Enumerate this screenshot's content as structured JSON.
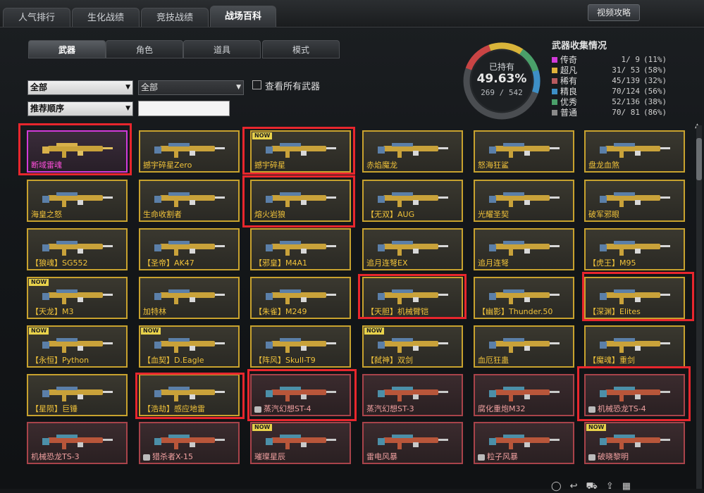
{
  "top_tabs": [
    "人气排行",
    "生化战绩",
    "竞技战绩",
    "战场百科"
  ],
  "video_button": "视频攻略",
  "sub_tabs": [
    "武器",
    "角色",
    "道具",
    "模式"
  ],
  "filters": {
    "category": "全部",
    "subcategory": "全部",
    "sort": "推荐顺序",
    "search_value": "",
    "view_all_label": "查看所有武器"
  },
  "owned": {
    "label": "已持有",
    "percent": "49.63%",
    "count": "269 / 542",
    "fraction": 0.4963
  },
  "collection": {
    "title": "武器收集情况",
    "rows": [
      {
        "tier": "传奇",
        "count": "1/  9",
        "pct": "(11%)",
        "color": "#d23ad9"
      },
      {
        "tier": "超凡",
        "count": "31/ 53",
        "pct": "(58%)",
        "color": "#e0b23a"
      },
      {
        "tier": "稀有",
        "count": "45/139",
        "pct": "(32%)",
        "color": "#b85a5f"
      },
      {
        "tier": "精良",
        "count": "70/124",
        "pct": "(56%)",
        "color": "#3d8fc6"
      },
      {
        "tier": "优秀",
        "count": "52/136",
        "pct": "(38%)",
        "color": "#4aa06a"
      },
      {
        "tier": "普通",
        "count": "70/ 81",
        "pct": "(86%)",
        "color": "#8a8a8a"
      }
    ]
  },
  "ring_colors": {
    "segment_a": "#c94444",
    "segment_b": "#d9b43a",
    "segment_c": "#4aa06a",
    "segment_d": "#3d8fc6",
    "track": "#4a4d51"
  },
  "weapons": [
    [
      {
        "name": "断域雷魂",
        "tier": "legend"
      },
      {
        "name": "撼宇碎星Zero"
      },
      {
        "name": "撼宇碎星",
        "now": true
      },
      {
        "name": "赤焰魔龙"
      },
      {
        "name": "怒海狂鲨"
      },
      {
        "name": "盘龙血煞"
      }
    ],
    [
      {
        "name": "海皇之怒"
      },
      {
        "name": "生命收割者"
      },
      {
        "name": "熔火岩狼"
      },
      {
        "name": "【无双】AUG"
      },
      {
        "name": "光耀圣契"
      },
      {
        "name": "破军邪眼"
      }
    ],
    [
      {
        "name": "【狼魂】SG552"
      },
      {
        "name": "【圣帝】AK47"
      },
      {
        "name": "【邪皇】M4A1"
      },
      {
        "name": "追月连弩EX"
      },
      {
        "name": "追月连弩"
      },
      {
        "name": "【虎王】M95"
      }
    ],
    [
      {
        "name": "【天龙】M3",
        "now": true
      },
      {
        "name": "加特林"
      },
      {
        "name": "【朱雀】M249"
      },
      {
        "name": "【天胆】机械臂铠"
      },
      {
        "name": "【幽影】Thunder.50"
      },
      {
        "name": "【深渊】Elites"
      }
    ],
    [
      {
        "name": "【永恒】Python",
        "now": true
      },
      {
        "name": "【血契】D.Eagle",
        "now": true
      },
      {
        "name": "【阵风】Skull-T9"
      },
      {
        "name": "【弑神】双剑",
        "now": true
      },
      {
        "name": "血厄狂蛊"
      },
      {
        "name": "【魔魂】重剑"
      }
    ],
    [
      {
        "name": "【星陨】巨锤"
      },
      {
        "name": "【浩劫】感应地雷"
      },
      {
        "name": "蒸汽幻想ST-4",
        "tier": "rare",
        "cam": true
      },
      {
        "name": "蒸汽幻想ST-3",
        "tier": "rare"
      },
      {
        "name": "腐化重炮M32",
        "tier": "rare"
      },
      {
        "name": "机械恐龙TS-4",
        "tier": "rare",
        "cam": true
      }
    ],
    [
      {
        "name": "机械恐龙TS-3",
        "tier": "rare"
      },
      {
        "name": "猎杀者X-15",
        "tier": "rare",
        "cam": true
      },
      {
        "name": "璀璨星辰",
        "tier": "rare",
        "now": true
      },
      {
        "name": "雷电风暴",
        "tier": "rare"
      },
      {
        "name": "粒子风暴",
        "tier": "rare",
        "cam": true
      },
      {
        "name": "破晓黎明",
        "tier": "rare",
        "now": true,
        "cam": true
      }
    ]
  ],
  "now_badge": "NOW"
}
